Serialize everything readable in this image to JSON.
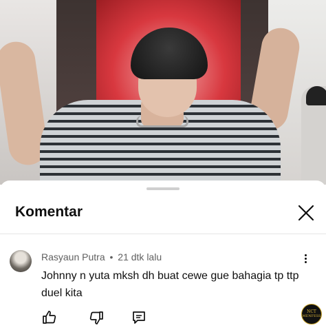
{
  "sheet": {
    "title": "Komentar"
  },
  "comment": {
    "author": "Rasyaun Putra",
    "separator": "•",
    "timestamp": "21 dtk lalu",
    "text": "Johnny n yuta mksh dh buat cewe gue bahagia tp ttp duel kita"
  },
  "badge": {
    "line1": "NCT",
    "line2": "MENFESS"
  },
  "icons": {
    "close": "close-icon",
    "more": "more-vert-icon",
    "like": "thumb-up-icon",
    "dislike": "thumb-down-icon",
    "reply": "reply-icon"
  },
  "colors": {
    "text_primary": "#0f0f0f",
    "text_secondary": "#606060",
    "divider": "#e5e5e5"
  }
}
